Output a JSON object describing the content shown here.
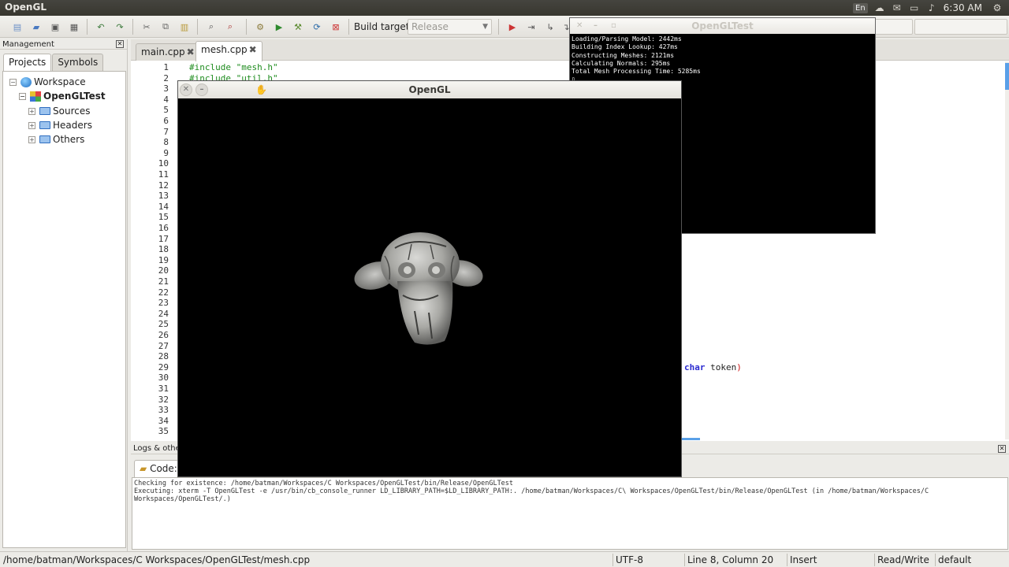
{
  "panel": {
    "app_title": "OpenGL",
    "lang": "En",
    "clock": "6:30 AM"
  },
  "toolbar": {
    "build_target_label": "Build target:",
    "build_target_value": "Release"
  },
  "management": {
    "header": "Management",
    "tabs": [
      "Projects",
      "Symbols"
    ],
    "tree": {
      "workspace": "Workspace",
      "project": "OpenGLTest",
      "folders": [
        "Sources",
        "Headers",
        "Others"
      ]
    }
  },
  "editor": {
    "tabs": [
      {
        "label": "main.cpp"
      },
      {
        "label": "mesh.cpp"
      }
    ],
    "line_numbers": [
      "1",
      "2",
      "3",
      "4",
      "5",
      "6",
      "7",
      "8",
      "9",
      "10",
      "11",
      "12",
      "13",
      "14",
      "15",
      "16",
      "17",
      "18",
      "19",
      "20",
      "21",
      "22",
      "23",
      "24",
      "25",
      "26",
      "27",
      "28",
      "29",
      "30",
      "31",
      "32",
      "33",
      "34",
      "35"
    ],
    "code_line1": "#include \"mesh.h\"",
    "code_line2": "#include \"util.h\"",
    "code_partial_kw": "char",
    "code_partial_rest": " token",
    "code_partial_paren": ")"
  },
  "logs": {
    "header": "Logs & others",
    "tab_label": "Code::",
    "lines": [
      "Checking for existence: /home/batman/Workspaces/C Workspaces/OpenGLTest/bin/Release/OpenGLTest",
      "Executing: xterm -T OpenGLTest -e /usr/bin/cb_console_runner LD_LIBRARY_PATH=$LD_LIBRARY_PATH:. /home/batman/Workspaces/C\\ Workspaces/OpenGLTest/bin/Release/OpenGLTest  (in /home/batman/Workspaces/C Workspaces/OpenGLTest/.)"
    ]
  },
  "status": {
    "path": "/home/batman/Workspaces/C Workspaces/OpenGLTest/mesh.cpp",
    "encoding": "UTF-8",
    "position": "Line 8, Column 20",
    "mode": "Insert",
    "access": "Read/Write",
    "profile": "default"
  },
  "xterm": {
    "title": "OpenGLTest",
    "lines": [
      "Loading/Parsing Model: 2442ms",
      "Building Index Lookup: 427ms",
      "Constructing Meshes: 2121ms",
      "Calculating Normals: 295ms",
      "Total Mesh Processing Time: 5285ms",
      "▯"
    ]
  },
  "glwindow": {
    "title": "OpenGL"
  }
}
